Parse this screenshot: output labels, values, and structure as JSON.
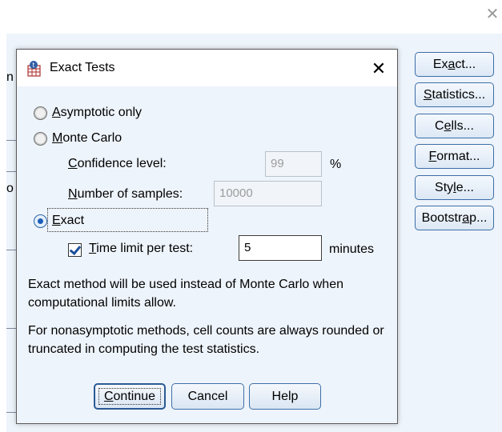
{
  "outer_window": {
    "close_glyph": "✕"
  },
  "parent": {
    "left_fragments": [
      "n",
      "o"
    ],
    "buttons": {
      "exact": "Exact...",
      "statistics": "Statistics...",
      "cells": "Cells...",
      "format": "Format...",
      "style": "Style...",
      "bootstrap": "Bootstrap..."
    }
  },
  "dialog": {
    "title": "Exact Tests",
    "close_glyph": "✕",
    "options": {
      "asymptotic_only": {
        "label": "Asymptotic only",
        "selected": false
      },
      "monte_carlo": {
        "label": "Monte Carlo",
        "selected": false
      },
      "exact": {
        "label": "Exact",
        "selected": true
      }
    },
    "monte_carlo_settings": {
      "confidence_label": "Confidence level:",
      "confidence_value": "99",
      "confidence_unit": "%",
      "samples_label": "Number of samples:",
      "samples_value": "10000"
    },
    "exact_settings": {
      "time_limit_label": "Time limit per test:",
      "time_limit_checked": true,
      "time_limit_value": "5",
      "time_limit_unit": "minutes"
    },
    "notes": [
      "Exact method will be used instead of Monte Carlo when computational limits allow.",
      "For nonasymptotic methods, cell counts are always rounded or truncated in computing the test statistics."
    ],
    "buttons": {
      "continue": "Continue",
      "cancel": "Cancel",
      "help": "Help"
    }
  },
  "colors": {
    "dialog_body": "#eef4fb",
    "button_border": "#3e6fa8",
    "radio_selected": "#1d5fb8"
  }
}
